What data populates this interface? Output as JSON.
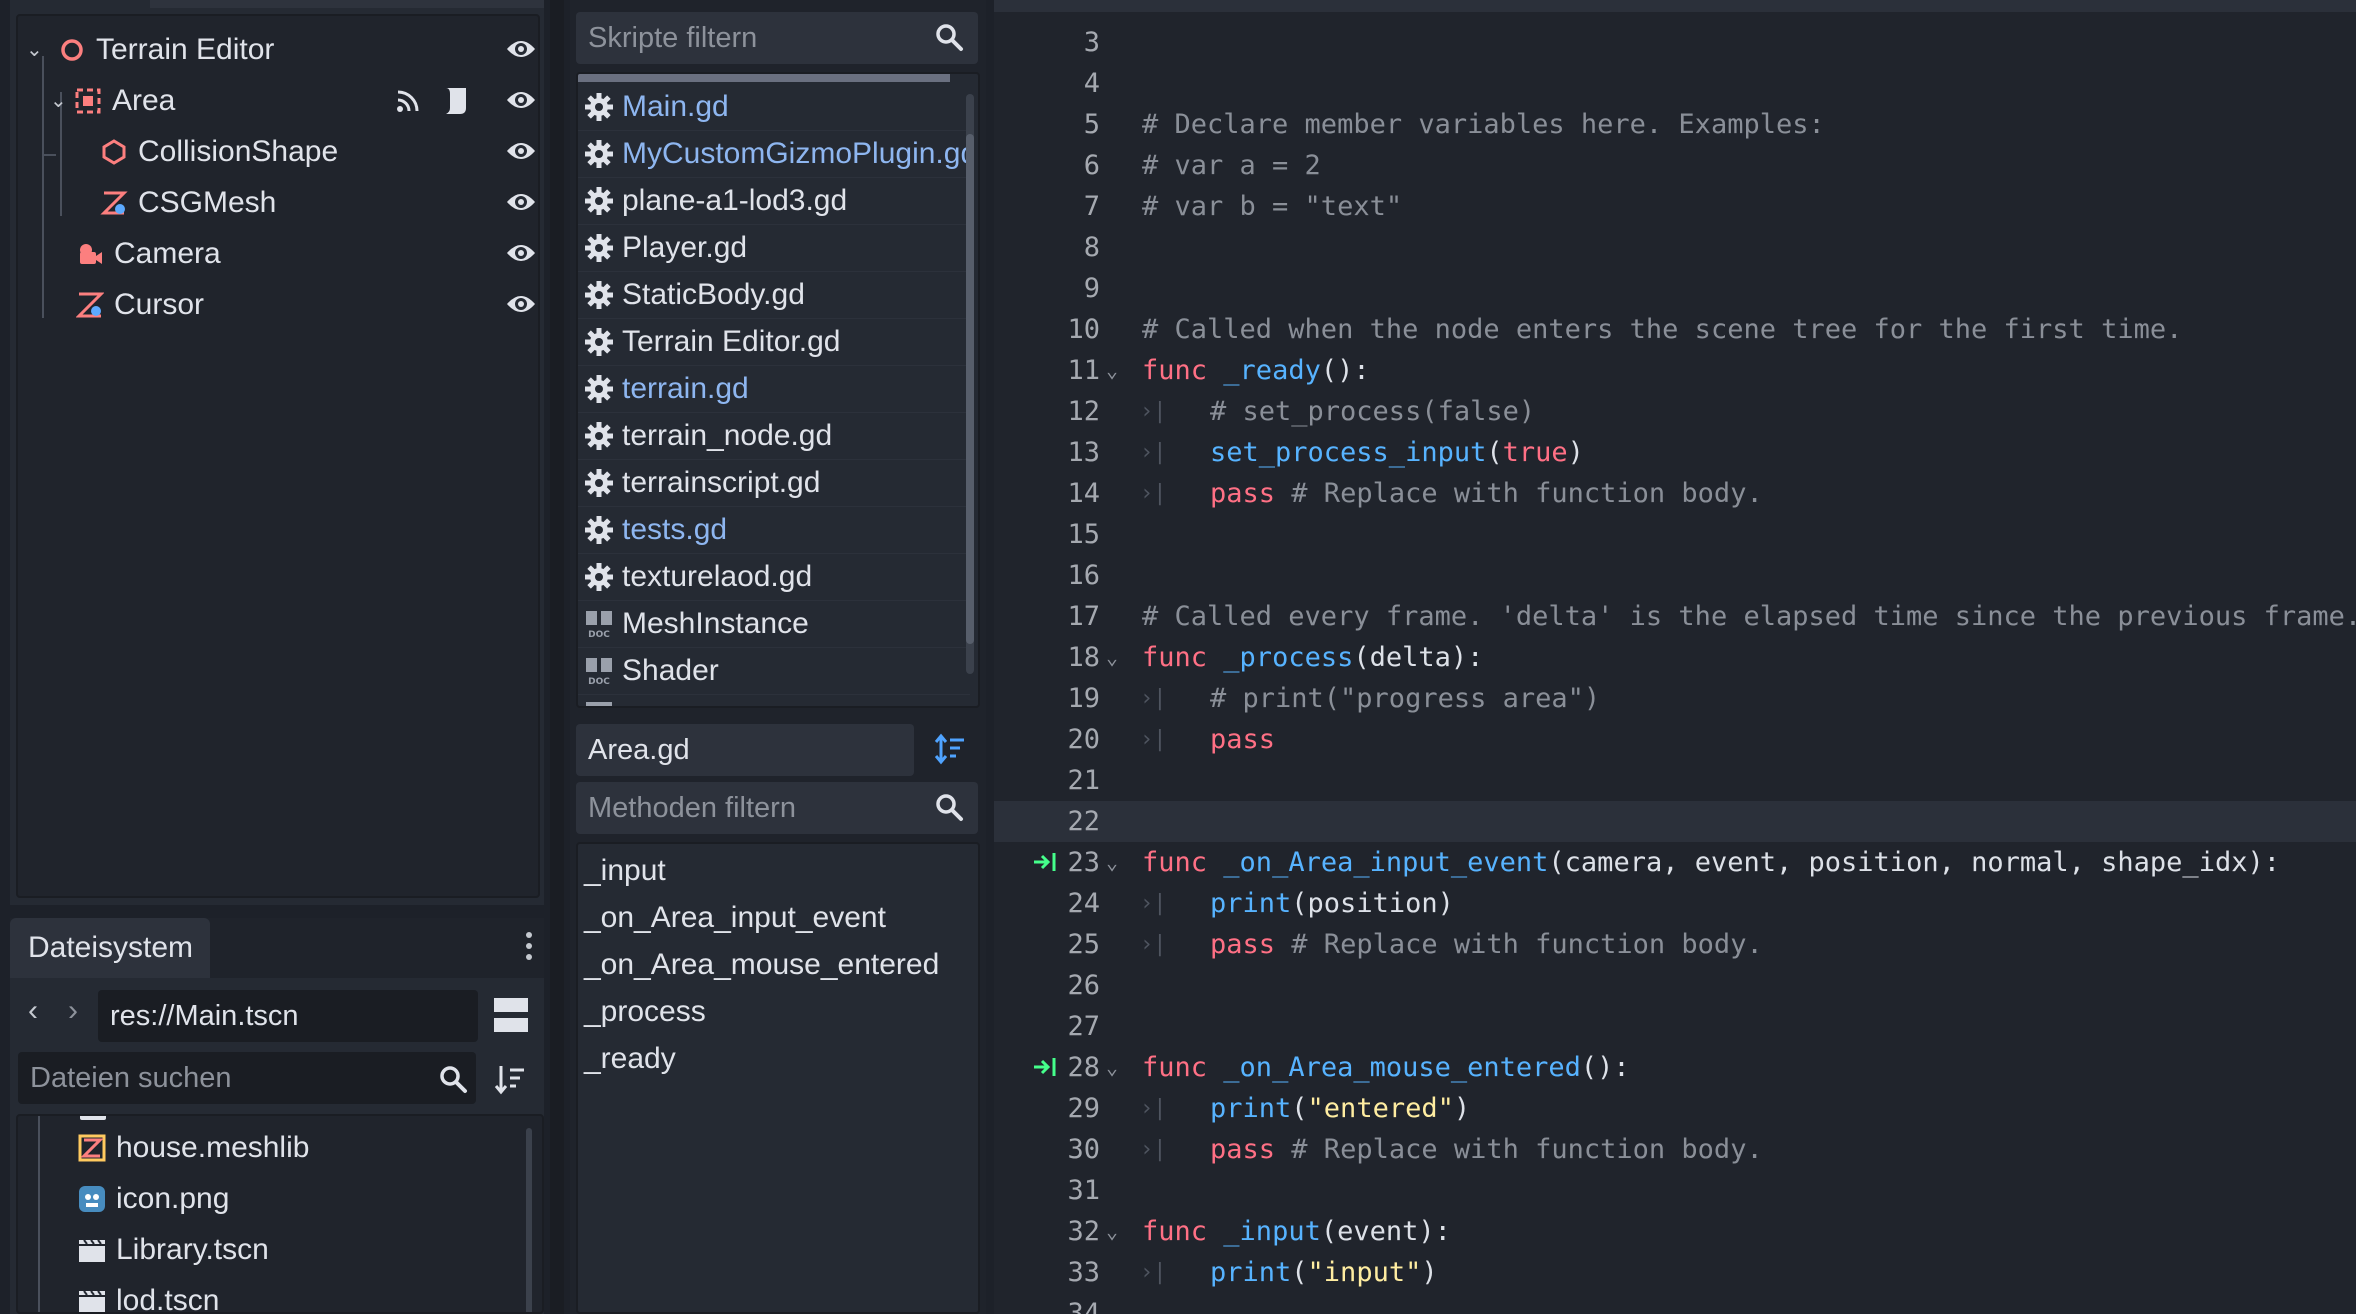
{
  "scene_tree": {
    "nodes": [
      {
        "label": "Terrain Editor",
        "icon": "spatial-node-icon"
      },
      {
        "label": "Area",
        "icon": "area-node-icon"
      },
      {
        "label": "CollisionShape",
        "icon": "collision-shape-icon"
      },
      {
        "label": "CSGMesh",
        "icon": "csg-mesh-icon"
      },
      {
        "label": "Camera",
        "icon": "camera-icon"
      },
      {
        "label": "Cursor",
        "icon": "mesh-instance-icon"
      }
    ]
  },
  "filesystem": {
    "tab_label": "Dateisystem",
    "path": "res://Main.tscn",
    "search_placeholder": "Dateien suchen",
    "files": [
      {
        "name": "house.meshlib",
        "icon": "mesh-library-icon"
      },
      {
        "name": "icon.png",
        "icon": "image-icon"
      },
      {
        "name": "Library.tscn",
        "icon": "scene-icon"
      },
      {
        "name": "lod.tscn",
        "icon": "scene-icon"
      }
    ]
  },
  "scripts": {
    "filter_placeholder": "Skripte filtern",
    "items": [
      {
        "name": "Main.gd",
        "highlight": true,
        "icon": "gear-icon"
      },
      {
        "name": "MyCustomGizmoPlugin.gd",
        "highlight": true,
        "icon": "gear-icon"
      },
      {
        "name": "plane-a1-lod3.gd",
        "highlight": false,
        "icon": "gear-icon"
      },
      {
        "name": "Player.gd",
        "highlight": false,
        "icon": "gear-icon"
      },
      {
        "name": "StaticBody.gd",
        "highlight": false,
        "icon": "gear-icon"
      },
      {
        "name": "Terrain Editor.gd",
        "highlight": false,
        "icon": "gear-icon"
      },
      {
        "name": "terrain.gd",
        "highlight": true,
        "icon": "gear-icon"
      },
      {
        "name": "terrain_node.gd",
        "highlight": false,
        "icon": "gear-icon"
      },
      {
        "name": "terrainscript.gd",
        "highlight": false,
        "icon": "gear-icon"
      },
      {
        "name": "tests.gd",
        "highlight": true,
        "icon": "gear-icon"
      },
      {
        "name": "texturelaod.gd",
        "highlight": false,
        "icon": "gear-icon"
      },
      {
        "name": "MeshInstance",
        "highlight": false,
        "icon": "doc-icon"
      },
      {
        "name": "Shader",
        "highlight": false,
        "icon": "doc-icon"
      }
    ],
    "current_script": "Area.gd",
    "methods_placeholder": "Methoden filtern",
    "methods": [
      "_input",
      "_on_Area_input_event",
      "_on_Area_mouse_entered",
      "_process",
      "_ready"
    ]
  },
  "editor": {
    "current_line": 22,
    "lines": [
      {
        "n": "3",
        "code": ""
      },
      {
        "n": "4",
        "code": ""
      },
      {
        "n": "5",
        "code": "# Declare member variables here. Examples:"
      },
      {
        "n": "6",
        "code": "# var a = 2"
      },
      {
        "n": "7",
        "code": "# var b = \"text\""
      },
      {
        "n": "8",
        "code": ""
      },
      {
        "n": "9",
        "code": ""
      },
      {
        "n": "10",
        "code": "# Called when the node enters the scene tree for the first time."
      },
      {
        "n": "11",
        "code": "func _ready():",
        "fold": true
      },
      {
        "n": "12",
        "code": "# set_process(false)",
        "indent": true
      },
      {
        "n": "13",
        "code": "set_process_input(true)",
        "indent": true
      },
      {
        "n": "14",
        "code": "pass # Replace with function body.",
        "indent": true
      },
      {
        "n": "15",
        "code": ""
      },
      {
        "n": "16",
        "code": ""
      },
      {
        "n": "17",
        "code": "# Called every frame. 'delta' is the elapsed time since the previous frame."
      },
      {
        "n": "18",
        "code": "func _process(delta):",
        "fold": true
      },
      {
        "n": "19",
        "code": "# print(\"progress area\")",
        "indent": true
      },
      {
        "n": "20",
        "code": "pass",
        "indent": true
      },
      {
        "n": "21",
        "code": ""
      },
      {
        "n": "22",
        "code": ""
      },
      {
        "n": "23",
        "code": "func _on_Area_input_event(camera, event, position, normal, shape_idx):",
        "fold": true,
        "signal": true
      },
      {
        "n": "24",
        "code": "print(position)",
        "indent": true
      },
      {
        "n": "25",
        "code": "pass # Replace with function body.",
        "indent": true
      },
      {
        "n": "26",
        "code": ""
      },
      {
        "n": "27",
        "code": ""
      },
      {
        "n": "28",
        "code": "func _on_Area_mouse_entered():",
        "fold": true,
        "signal": true
      },
      {
        "n": "29",
        "code": "print(\"entered\")",
        "indent": true
      },
      {
        "n": "30",
        "code": "pass # Replace with function body.",
        "indent": true
      },
      {
        "n": "31",
        "code": ""
      },
      {
        "n": "32",
        "code": "func _input(event):",
        "fold": true
      },
      {
        "n": "33",
        "code": "print(\"input\")",
        "indent": true
      },
      {
        "n": "34",
        "code": ""
      }
    ]
  },
  "colors": {
    "keyword": "#ff7085",
    "function": "#57b3ff",
    "comment": "#8a8f98",
    "string": "#ffeda1",
    "link": "#8eb6f0",
    "accent": "#4fa3ff"
  }
}
